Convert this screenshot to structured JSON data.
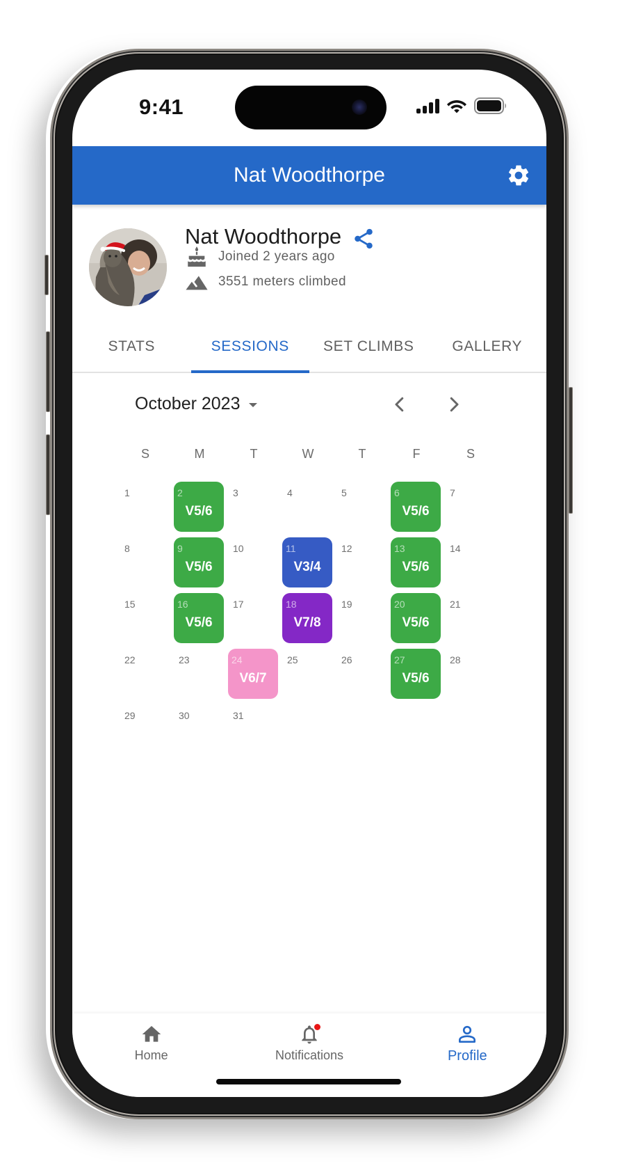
{
  "status_bar": {
    "time": "9:41"
  },
  "app_bar": {
    "title": "Nat Woodthorpe",
    "settings_icon": "gear-icon"
  },
  "profile": {
    "name": "Nat Woodthorpe",
    "avatar_alt": "Profile photo: person holding a cat wearing a Santa hat",
    "share_icon": "share-icon",
    "joined": "Joined 2 years ago",
    "climbed": "3551 meters climbed"
  },
  "tabs": [
    {
      "label": "STATS",
      "active": false
    },
    {
      "label": "SESSIONS",
      "active": true
    },
    {
      "label": "SET CLIMBS",
      "active": false
    },
    {
      "label": "GALLERY",
      "active": false
    }
  ],
  "calendar": {
    "month_label": "October 2023",
    "weekdays": [
      "S",
      "M",
      "T",
      "W",
      "T",
      "F",
      "S"
    ],
    "first_weekday_offset": 0,
    "days_in_month": 31,
    "grade_colors": {
      "V3/4": "#365bc4",
      "V5/6": "#3daa46",
      "V6/7": "#f495c9",
      "V7/8": "#8428c6"
    },
    "sessions": [
      {
        "day": 2,
        "grade": "V5/6"
      },
      {
        "day": 6,
        "grade": "V5/6"
      },
      {
        "day": 9,
        "grade": "V5/6"
      },
      {
        "day": 11,
        "grade": "V3/4"
      },
      {
        "day": 13,
        "grade": "V5/6"
      },
      {
        "day": 16,
        "grade": "V5/6"
      },
      {
        "day": 18,
        "grade": "V7/8"
      },
      {
        "day": 20,
        "grade": "V5/6"
      },
      {
        "day": 24,
        "grade": "V6/7"
      },
      {
        "day": 27,
        "grade": "V5/6"
      }
    ]
  },
  "bottom_nav": [
    {
      "label": "Home",
      "icon": "home-icon",
      "active": false
    },
    {
      "label": "Notifications",
      "icon": "bell-icon",
      "active": false,
      "badge": true
    },
    {
      "label": "Profile",
      "icon": "person-icon",
      "active": true
    }
  ],
  "colors": {
    "primary": "#2569c8",
    "badge": "#e81515"
  }
}
